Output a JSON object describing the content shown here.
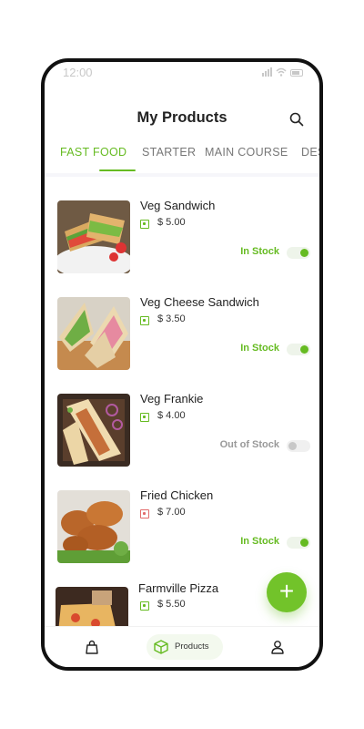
{
  "status_bar": {
    "time": "12:00"
  },
  "header": {
    "title": "My Products"
  },
  "tabs": [
    {
      "label": "FAST FOOD",
      "active": true
    },
    {
      "label": "STARTER"
    },
    {
      "label": "MAIN COURSE"
    },
    {
      "label": "DES"
    }
  ],
  "products": [
    {
      "name": "Veg Sandwich",
      "price": "$ 5.00",
      "stock": "In Stock",
      "in_stock": true,
      "type": "veg"
    },
    {
      "name": "Veg Cheese Sandwich",
      "price": "$ 3.50",
      "stock": "In Stock",
      "in_stock": true,
      "type": "veg"
    },
    {
      "name": "Veg Frankie",
      "price": "$ 4.00",
      "stock": "Out of Stock",
      "in_stock": false,
      "type": "veg"
    },
    {
      "name": "Fried Chicken",
      "price": "$ 7.00",
      "stock": "In Stock",
      "in_stock": true,
      "type": "non-veg"
    },
    {
      "name": "Farmville Pizza",
      "price": "$ 5.50",
      "type": "veg"
    }
  ],
  "fab": {
    "label": "+"
  },
  "bottom_nav": {
    "active_label": "Products"
  },
  "colors": {
    "accent": "#66bb22",
    "nonveg": "#e26a6a",
    "muted": "#999999"
  },
  "icons": [
    "search-icon",
    "bag-icon",
    "box-icon",
    "user-icon",
    "add-icon"
  ]
}
